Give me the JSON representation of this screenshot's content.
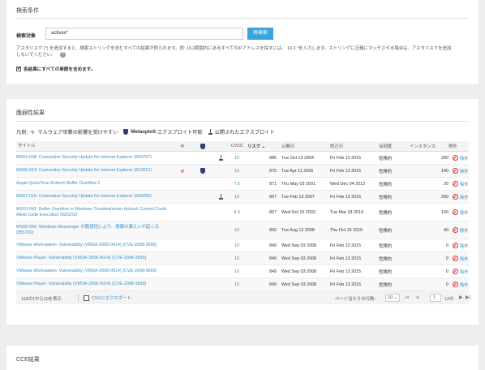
{
  "search": {
    "section_title": "検索条件",
    "label": "検索対象",
    "input_value": "activex*",
    "button_label": "再検索",
    "help_text": "アスタリスク (*) を追加すると、検索ストリングを含むすべての結果が得られます。例: 10.2範囲内にあるすべてのIPアドレスを探すには、 10.2 *を入力します。ストリングに正確にマッチさせる場合は、アスタリスクを追加しないでください。",
    "help_icon": "?",
    "checkbox_label": "各結果にすべての単語を含めます。"
  },
  "vuln": {
    "section_title": "脆弱性結果",
    "legend": {
      "prefix": "凡例:",
      "malware": "マルウェア攻撃の影響を受けやすい",
      "metasploit_brand": "Metasploit",
      "metasploit_rest": "-エクスプロイト可能",
      "exploit": "公開されたエクスプロイト"
    },
    "columns": {
      "title": "タイトル",
      "cvss": "CVSS",
      "risk": "リスク ⌄",
      "published": "公開日",
      "modified": "修正日",
      "severity": "深刻度",
      "instances": "インスタンス",
      "exceptions": "例外"
    },
    "rows": [
      {
        "title": "MS04-038: Cumulative Security Update for Internet Explorer (834707)",
        "malware": false,
        "metasploit": false,
        "exploit": true,
        "cvss": "10",
        "risk": "886",
        "published": "Tue Oct 12 2004",
        "modified": "Fri Feb 13 2015",
        "severity": "危険的",
        "instances": "260",
        "exception": "除外"
      },
      {
        "title": "MS06-013: Cumulative Security Update for Internet Explorer (912812)",
        "malware": true,
        "metasploit": true,
        "exploit": false,
        "cvss": "10",
        "risk": "875",
        "published": "Tue Apr 11 2006",
        "modified": "Fri Feb 13 2015",
        "severity": "危険的",
        "instances": "140",
        "exception": "除外"
      },
      {
        "title": "Apple QuickTime ActiveX Buffer Overflow 2",
        "malware": false,
        "metasploit": false,
        "exploit": false,
        "cvss": "7.6",
        "risk": "871",
        "published": "Thu May 03 2001",
        "modified": "Wed Dec 04 2013",
        "severity": "危険的",
        "instances": "20",
        "exception": "除外"
      },
      {
        "title": "MS07-016: Cumulative Security Update for Internet Explorer (928090)",
        "malware": false,
        "metasploit": false,
        "exploit": true,
        "cvss": "10",
        "risk": "867",
        "published": "Tue Feb 13 2007",
        "modified": "Fri Feb 13 2015",
        "severity": "危険的",
        "instances": "260",
        "exception": "除外"
      },
      {
        "title": "MS03-042: Buffer Overflow in Windows Troubleshooter ActiveX Control Could Allow Code Execution (826232)",
        "malware": false,
        "metasploit": false,
        "exploit": false,
        "cvss": "9.3",
        "risk": "857",
        "published": "Wed Oct 15 2003",
        "modified": "Tue Mar 18 2014",
        "severity": "危険的",
        "instances": "100",
        "exception": "除外"
      },
      {
        "title": "MS08-050: Windows Messenger の脆弱性により、情報の漏えいが起こる (955702)",
        "malware": false,
        "metasploit": false,
        "exploit": false,
        "cvss": "10",
        "risk": "850",
        "published": "Tue Aug 12 2008",
        "modified": "Thu Oct 15 2015",
        "severity": "危険的",
        "instances": "40",
        "exception": "除外"
      },
      {
        "title": "VMware Workstation: Vulnerability (VMSA-2008-0014) (CVE-2008-3695)",
        "malware": false,
        "metasploit": false,
        "exploit": false,
        "cvss": "10",
        "risk": "849",
        "published": "Wed Sep 03 2008",
        "modified": "Fri Feb 13 2015",
        "severity": "危険的",
        "instances": "0",
        "exception": "除外"
      },
      {
        "title": "VMware Player: Vulnerability (VMSA-2008-0014) (CVE-2008-3695)",
        "malware": false,
        "metasploit": false,
        "exploit": false,
        "cvss": "10",
        "risk": "849",
        "published": "Wed Sep 03 2008",
        "modified": "Fri Feb 13 2015",
        "severity": "危険的",
        "instances": "0",
        "exception": "除外"
      },
      {
        "title": "VMware Workstation: Vulnerability (VMSA-2008-0014) (CVE-2008-3693)",
        "malware": false,
        "metasploit": false,
        "exploit": false,
        "cvss": "10",
        "risk": "849",
        "published": "Wed Sep 03 2008",
        "modified": "Fri Feb 13 2015",
        "severity": "危険的",
        "instances": "0",
        "exception": "除外"
      },
      {
        "title": "VMware Player: Vulnerability (VMSA-2008-0014) (CVE-2008-3693)",
        "malware": false,
        "metasploit": false,
        "exploit": false,
        "cvss": "10",
        "risk": "849",
        "published": "Wed Sep 03 2008",
        "modified": "Fri Feb 13 2015",
        "severity": "危険的",
        "instances": "0",
        "exception": "除外"
      }
    ],
    "footer": {
      "count_text": "119の1から10を表示",
      "export_label": "CSVにエクスポート",
      "rows_per_page_label": "ページ当たりの行数:",
      "rows_per_page_value": "10",
      "page_value": "1",
      "page_of": "12の"
    }
  },
  "cce": {
    "section_title": "CCE結果"
  },
  "colors": {
    "accent": "#3aa4dc",
    "link": "#3a8ec8",
    "danger": "#d9332a",
    "background": "#eeeeee"
  }
}
